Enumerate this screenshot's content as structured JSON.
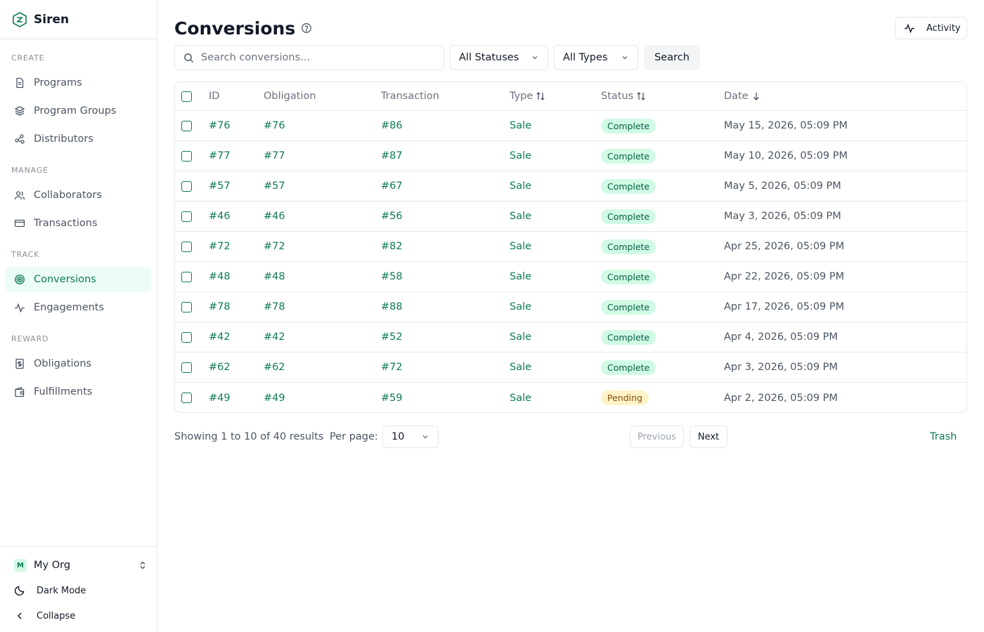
{
  "app": {
    "name": "Siren"
  },
  "sidebar": {
    "sections": [
      {
        "label": "CREATE",
        "items": [
          {
            "label": "Programs",
            "icon": "file-text-icon"
          },
          {
            "label": "Program Groups",
            "icon": "layers-icon"
          },
          {
            "label": "Distributors",
            "icon": "network-icon"
          }
        ]
      },
      {
        "label": "MANAGE",
        "items": [
          {
            "label": "Collaborators",
            "icon": "users-icon"
          },
          {
            "label": "Transactions",
            "icon": "credit-card-icon"
          }
        ]
      },
      {
        "label": "TRACK",
        "items": [
          {
            "label": "Conversions",
            "icon": "target-icon",
            "active": true
          },
          {
            "label": "Engagements",
            "icon": "activity-icon"
          }
        ]
      },
      {
        "label": "REWARD",
        "items": [
          {
            "label": "Obligations",
            "icon": "receipt-icon"
          },
          {
            "label": "Fulfillments",
            "icon": "wallet-icon"
          }
        ]
      }
    ],
    "footer": {
      "org_badge": "M",
      "org_name": "My Org",
      "dark_mode_label": "Dark Mode",
      "collapse_label": "Collapse"
    }
  },
  "page": {
    "title": "Conversions",
    "activity_label": "Activity",
    "search": {
      "placeholder": "Search conversions...",
      "value": ""
    },
    "status_filter": "All Statuses",
    "type_filter": "All Types",
    "search_button": "Search"
  },
  "table": {
    "columns": [
      "ID",
      "Obligation",
      "Transaction",
      "Type",
      "Status",
      "Date"
    ],
    "rows": [
      {
        "id": "#76",
        "obligation": "#76",
        "transaction": "#86",
        "type": "Sale",
        "status": "Complete",
        "date": "May 15, 2026, 05:09 PM"
      },
      {
        "id": "#77",
        "obligation": "#77",
        "transaction": "#87",
        "type": "Sale",
        "status": "Complete",
        "date": "May 10, 2026, 05:09 PM"
      },
      {
        "id": "#57",
        "obligation": "#57",
        "transaction": "#67",
        "type": "Sale",
        "status": "Complete",
        "date": "May 5, 2026, 05:09 PM"
      },
      {
        "id": "#46",
        "obligation": "#46",
        "transaction": "#56",
        "type": "Sale",
        "status": "Complete",
        "date": "May 3, 2026, 05:09 PM"
      },
      {
        "id": "#72",
        "obligation": "#72",
        "transaction": "#82",
        "type": "Sale",
        "status": "Complete",
        "date": "Apr 25, 2026, 05:09 PM"
      },
      {
        "id": "#48",
        "obligation": "#48",
        "transaction": "#58",
        "type": "Sale",
        "status": "Complete",
        "date": "Apr 22, 2026, 05:09 PM"
      },
      {
        "id": "#78",
        "obligation": "#78",
        "transaction": "#88",
        "type": "Sale",
        "status": "Complete",
        "date": "Apr 17, 2026, 05:09 PM"
      },
      {
        "id": "#42",
        "obligation": "#42",
        "transaction": "#52",
        "type": "Sale",
        "status": "Complete",
        "date": "Apr 4, 2026, 05:09 PM"
      },
      {
        "id": "#62",
        "obligation": "#62",
        "transaction": "#72",
        "type": "Sale",
        "status": "Complete",
        "date": "Apr 3, 2026, 05:09 PM"
      },
      {
        "id": "#49",
        "obligation": "#49",
        "transaction": "#59",
        "type": "Sale",
        "status": "Pending",
        "date": "Apr 2, 2026, 05:09 PM"
      }
    ]
  },
  "pagination": {
    "showing_text": "Showing 1 to 10 of 40 results",
    "per_page_label": "Per page:",
    "per_page_value": "10",
    "previous_label": "Previous",
    "next_label": "Next",
    "trash_label": "Trash"
  },
  "colors": {
    "accent": "#0f7a55",
    "active_bg": "#ecfdf5",
    "complete_bg": "#d1fae5",
    "pending_bg": "#fef3c7"
  }
}
